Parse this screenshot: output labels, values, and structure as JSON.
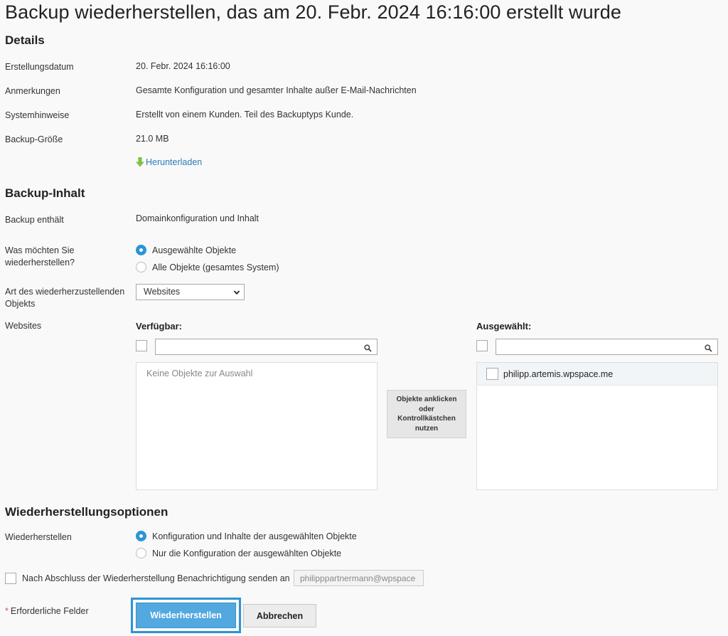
{
  "page": {
    "title": "Backup wiederherstellen, das am 20. Febr. 2024 16:16:00 erstellt wurde"
  },
  "details": {
    "heading": "Details",
    "rows": [
      {
        "label": "Erstellungsdatum",
        "value": "20. Febr. 2024 16:16:00"
      },
      {
        "label": "Anmerkungen",
        "value": "Gesamte Konfiguration und gesamter Inhalte außer E-Mail-Nachrichten"
      },
      {
        "label": "Systemhinweise",
        "value": "Erstellt von einem Kunden. Teil des Backuptyps Kunde."
      },
      {
        "label": "Backup-Größe",
        "value": "21.0 MB"
      }
    ],
    "download_label": "Herunterladen",
    "download_icon": "download-arrow-icon",
    "download_icon_color": "#7cc242"
  },
  "content": {
    "heading": "Backup-Inhalt",
    "contains_label": "Backup enthält",
    "contains_value": "Domainkonfiguration und Inhalt",
    "restore_what_label": "Was möchten Sie wiederherstellen?",
    "restore_what_options": [
      {
        "label": "Ausgewählte Objekte",
        "checked": true
      },
      {
        "label": "Alle Objekte (gesamtes System)",
        "checked": false
      }
    ],
    "object_type_label": "Art des wiederherzustellenden Objekts",
    "object_type_value": "Websites",
    "websites_label": "Websites",
    "available": {
      "heading": "Verfügbar:",
      "search_value": "",
      "empty_text": "Keine Objekte zur Auswahl"
    },
    "move_button": "Objekte anklicken oder Kontrollkästchen nutzen",
    "selected": {
      "heading": "Ausgewählt:",
      "search_value": "",
      "items": [
        "philipp.artemis.wpspace.me"
      ]
    }
  },
  "options": {
    "heading": "Wiederherstellungsoptionen",
    "restore_label": "Wiederherstellen",
    "restore_options": [
      {
        "label": "Konfiguration und Inhalte der ausgewählten Objekte",
        "checked": true
      },
      {
        "label": "Nur die Konfiguration der ausgewählten Objekte",
        "checked": false
      }
    ],
    "notify_label": "Nach Abschluss der Wiederherstellung Benachrichtigung senden an",
    "notify_checked": false,
    "notify_email": "philipppartnermann@wpspace"
  },
  "footer": {
    "required_star": "*",
    "required_text": "Erforderliche Felder",
    "primary_button": "Wiederherstellen",
    "cancel_button": "Abbrechen"
  },
  "colors": {
    "accent": "#2c94d6",
    "link": "#2c7bb6",
    "primary_button": "#52a8df"
  }
}
